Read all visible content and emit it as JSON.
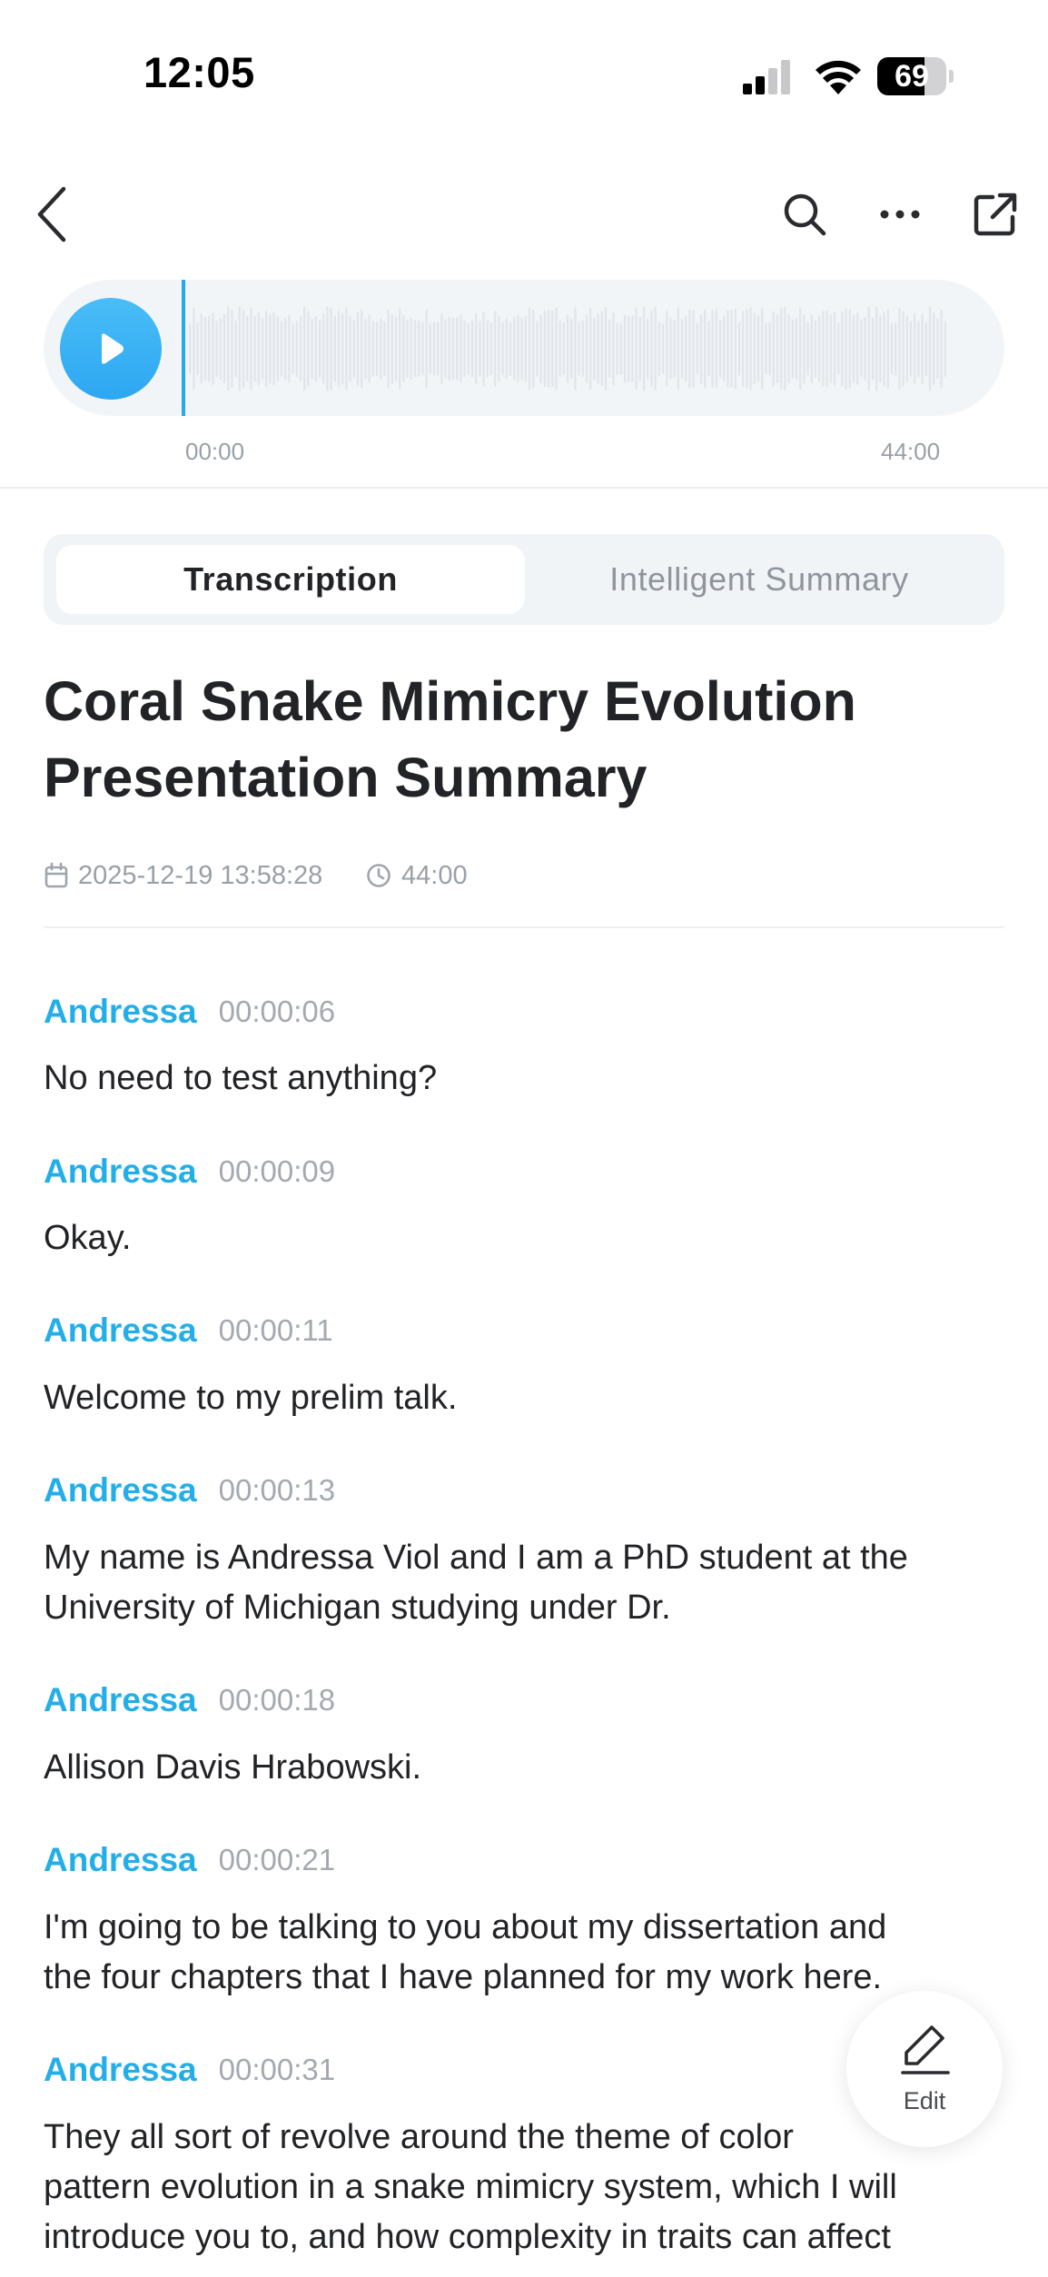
{
  "status_bar": {
    "time": "12:05",
    "battery": "69",
    "battery_level": 0.69
  },
  "nav": {
    "icons": [
      "chevron-left-icon",
      "search-icon",
      "ellipsis-icon",
      "share-external-icon"
    ]
  },
  "player": {
    "start_time": "00:00",
    "end_time": "44:00",
    "progress": 0,
    "colors": {
      "play": "#34aaf2",
      "track": "#f2f5f8",
      "wave": "#e2e6eb",
      "cursor": "#2aa8ee"
    }
  },
  "tabs": [
    {
      "label": "Transcription",
      "active": true
    },
    {
      "label": "Intelligent Summary",
      "active": false
    }
  ],
  "recording": {
    "title_line1": "Coral Snake Mimicry Evolution",
    "title_line2": "Presentation Summary",
    "date": "2025-12-19 13:58:28",
    "duration": "44:00"
  },
  "transcript": [
    {
      "speaker": "Andressa",
      "time": "00:00:06",
      "lines": [
        "No need to test anything?"
      ]
    },
    {
      "speaker": "Andressa",
      "time": "00:00:09",
      "lines": [
        "Okay."
      ]
    },
    {
      "speaker": "Andressa",
      "time": "00:00:11",
      "lines": [
        "Welcome to my prelim talk."
      ]
    },
    {
      "speaker": "Andressa",
      "time": "00:00:13",
      "lines": [
        "My name is Andressa Viol and I am a PhD student at the",
        "University of Michigan studying under Dr."
      ]
    },
    {
      "speaker": "Andressa",
      "time": "00:00:18",
      "lines": [
        "Allison Davis Hrabowski."
      ]
    },
    {
      "speaker": "Andressa",
      "time": "00:00:21",
      "lines": [
        "I'm going to be talking to you about my dissertation and",
        "the four chapters that I have planned for my work here."
      ]
    },
    {
      "speaker": "Andressa",
      "time": "00:00:31",
      "lines": [
        "They all sort of revolve around the theme of color",
        "pattern evolution in a snake mimicry system, which I will",
        "introduce you to, and how complexity in traits can affect"
      ]
    }
  ],
  "colors": {
    "speaker": "#24aee8",
    "accent": "#34aaf2"
  },
  "edit_button": {
    "label": "Edit",
    "icon": "pencil-icon"
  }
}
